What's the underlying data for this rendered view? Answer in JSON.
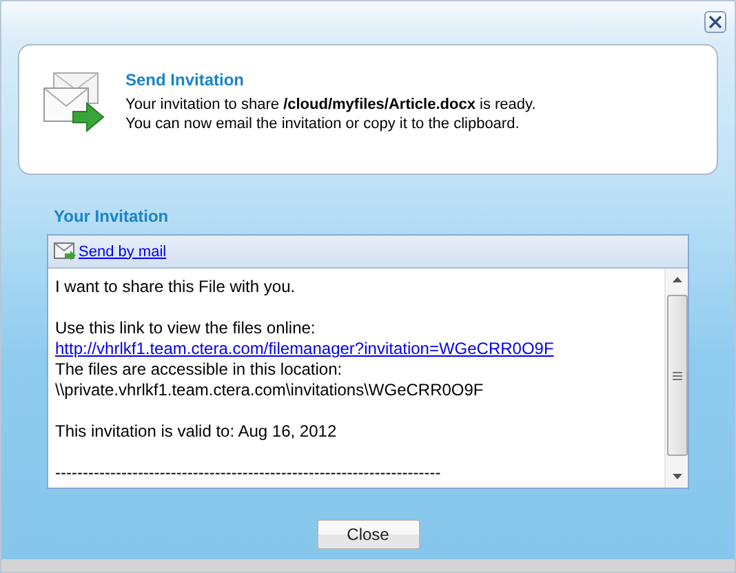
{
  "header": {
    "title": "Send Invitation",
    "lines": [
      "Your invitation to share **/cloud/myfiles/Article.docx** is ready.",
      "You can now email the invitation or copy it to the clipboard."
    ]
  },
  "invitation": {
    "title": "Your Invitation",
    "toolbar": {
      "link": "Send by mail"
    },
    "message": [
      {
        "kind": "text",
        "text": "I want to share this File with you."
      },
      {
        "kind": "blank"
      },
      {
        "kind": "text",
        "text": "Use this link to view the files online:"
      },
      {
        "kind": "link",
        "text": "http://vhrlkf1.team.ctera.com/filemanager?invitation=WGeCRR0O9F"
      },
      {
        "kind": "text",
        "text": "The files are accessible in this location:"
      },
      {
        "kind": "text",
        "text": "\\\\private.vhrlkf1.team.ctera.com\\invitations\\WGeCRR0O9F"
      },
      {
        "kind": "blank"
      },
      {
        "kind": "text",
        "text": "This invitation is valid to: Aug 16, 2012"
      },
      {
        "kind": "blank"
      },
      {
        "kind": "text",
        "text": "----------------------------------------------------------------------"
      }
    ]
  },
  "buttons": [
    {
      "label": "Close"
    }
  ]
}
